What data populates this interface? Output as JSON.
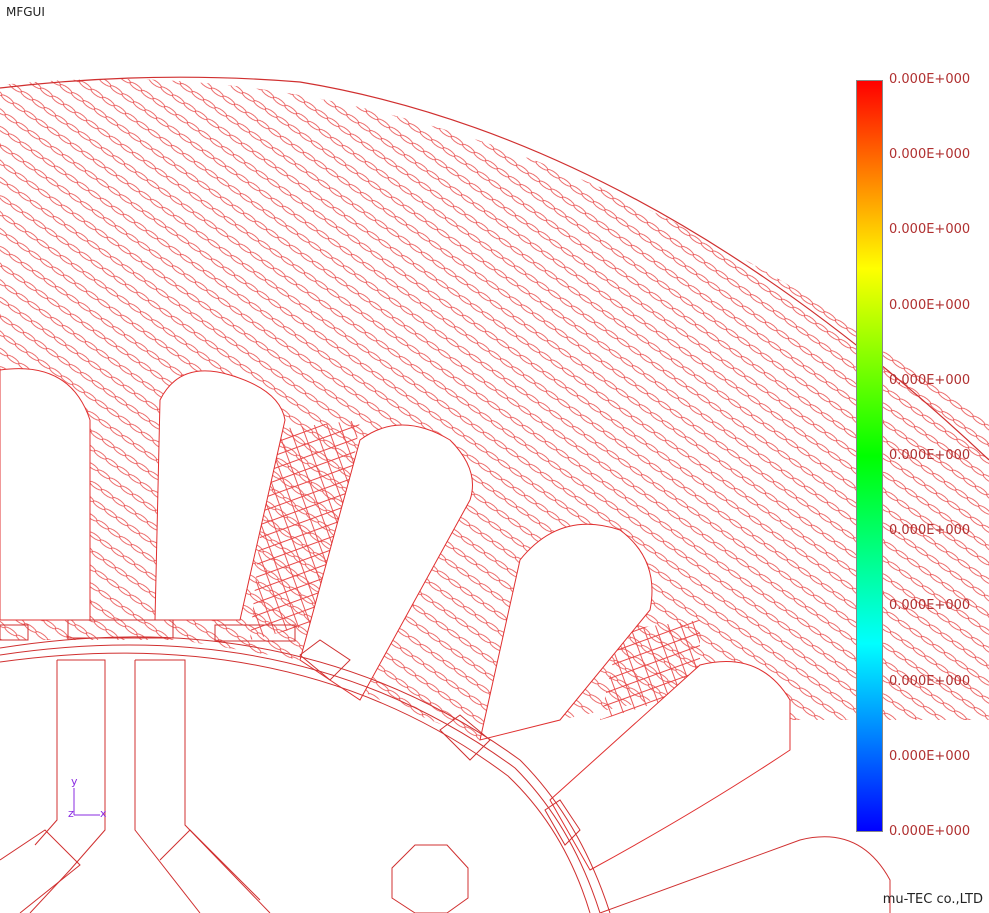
{
  "app": {
    "title": "MFGUI"
  },
  "colorbar": {
    "labels": [
      "0.000E+000",
      "0.000E+000",
      "0.000E+000",
      "0.000E+000",
      "0.000E+000",
      "0.000E+000",
      "0.000E+000",
      "0.000E+000",
      "0.000E+000",
      "0.000E+000",
      "0.000E+000"
    ],
    "colors": [
      "#ff0000",
      "#ff8000",
      "#ffff00",
      "#80ff00",
      "#00ff00",
      "#00ff80",
      "#00ffff",
      "#0080ff",
      "#0000ff"
    ]
  },
  "axes": {
    "y": "y",
    "z": "z",
    "x": "x"
  },
  "footer": {
    "company": "mu-TEC co.,LTD"
  },
  "plot": {
    "line_color": "#e03030",
    "hatch_color": "#e84848"
  }
}
